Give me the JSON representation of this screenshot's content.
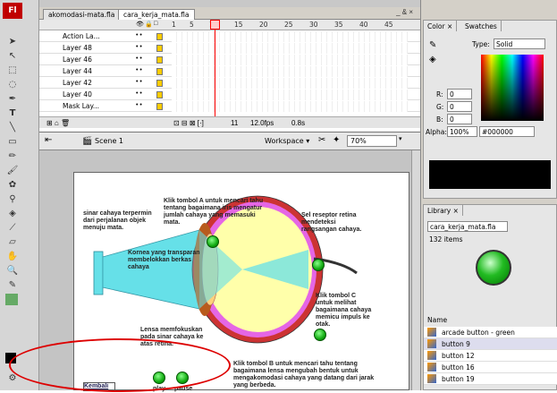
{
  "tools": {
    "logo": "Fl"
  },
  "doc_tabs": [
    "akomodasi-mata.fla",
    "cara_kerja_mata.fla"
  ],
  "window_controls": "_ & ×",
  "timeline": {
    "frame_numbers": [
      "1",
      "5",
      "10",
      "15",
      "20",
      "25",
      "30",
      "35",
      "40",
      "45"
    ],
    "layers": [
      "Action La...",
      "Layer 48",
      "Layer 46",
      "Layer 44",
      "Layer 42",
      "Layer 40",
      "Mask Lay..."
    ],
    "status": {
      "frame": "11",
      "fps": "12.0fps",
      "time": "0.8s"
    }
  },
  "edit_bar": {
    "scene": "Scene 1",
    "workspace": "Workspace ▾",
    "zoom": "70%"
  },
  "stage": {
    "text1": "sinar cahaya terpermin dari perjalanan objek menuju mata.",
    "text2": "Klik tombol A untuk mencari tahu tentang bagaimana iris mengatur jumlah cahaya yang memasuki mata.",
    "text3": "Sel reseptor retina mendeteksi rangsangan cahaya.",
    "text4": "Kornea yang transparan membelokkan berkas cahaya",
    "text5": "Klik tombol C untuk melihat bagaimana cahaya memicu impuls ke otak.",
    "text6": "Lensa memfokuskan pada sinar cahaya ke atas retina.",
    "text7": "Klik tombol B untuk mencari tahu tentang bagaimana lensa mengubah bentuk untuk mengakomodasi cahaya yang datang dari jarak yang berbeda.",
    "kembali": "Kembali",
    "play": "play",
    "pause": "pause"
  },
  "color_panel": {
    "tabs": [
      "Color ×",
      "Swatches"
    ],
    "type_label": "Type:",
    "type_value": "Solid",
    "r_label": "R:",
    "r": "0",
    "g_label": "G:",
    "g": "0",
    "b_label": "B:",
    "b": "0",
    "alpha_label": "Alpha:",
    "alpha": "100%",
    "hex": "#000000"
  },
  "library": {
    "tab": "Library ×",
    "doc": "cara_kerja_mata.fla",
    "count": "132 items",
    "name_header": "Name",
    "items": [
      "arcade button - green",
      "button 9",
      "button 12",
      "button 16",
      "button 19"
    ]
  },
  "colors": {
    "accent_green": "#22aa22",
    "playhead": "#ff0000",
    "annotation": "#dd0000"
  }
}
